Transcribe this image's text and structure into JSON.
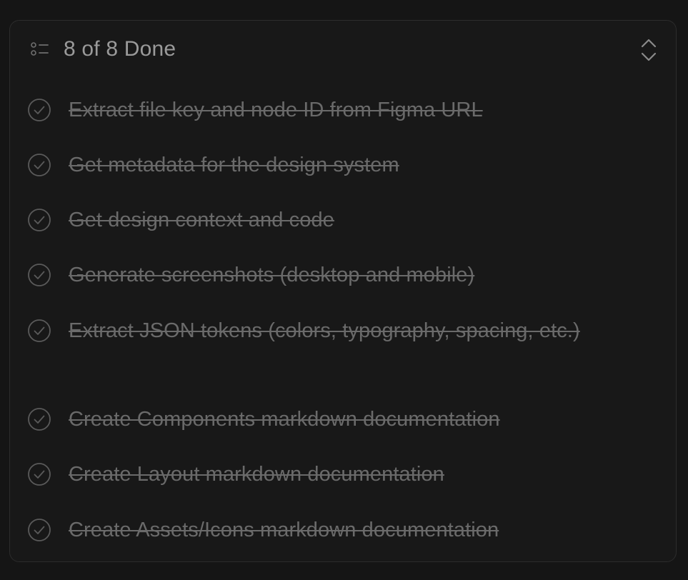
{
  "header": {
    "title": "8 of 8 Done"
  },
  "icons": {
    "header": "list-icon",
    "toggle": "chevron-up-down-icon",
    "item": "check-circle-icon"
  },
  "colors": {
    "background": "#151515",
    "panel": "#181818",
    "border": "#2c2c2c",
    "title": "#9a9a9a",
    "item_text": "#6a6a6a"
  },
  "tasks": [
    {
      "label": "Extract file key and node ID from Figma URL",
      "done": true
    },
    {
      "label": "Get metadata for the design system",
      "done": true
    },
    {
      "label": "Get design context and code",
      "done": true
    },
    {
      "label": "Generate screenshots (desktop and mobile)",
      "done": true
    },
    {
      "label": "Extract JSON tokens (colors, typography, spacing, etc.)",
      "done": true
    },
    {
      "label": "Create Components markdown documentation",
      "done": true
    },
    {
      "label": "Create Layout markdown documentation",
      "done": true
    },
    {
      "label": "Create Assets/Icons markdown documentation",
      "done": true
    }
  ]
}
